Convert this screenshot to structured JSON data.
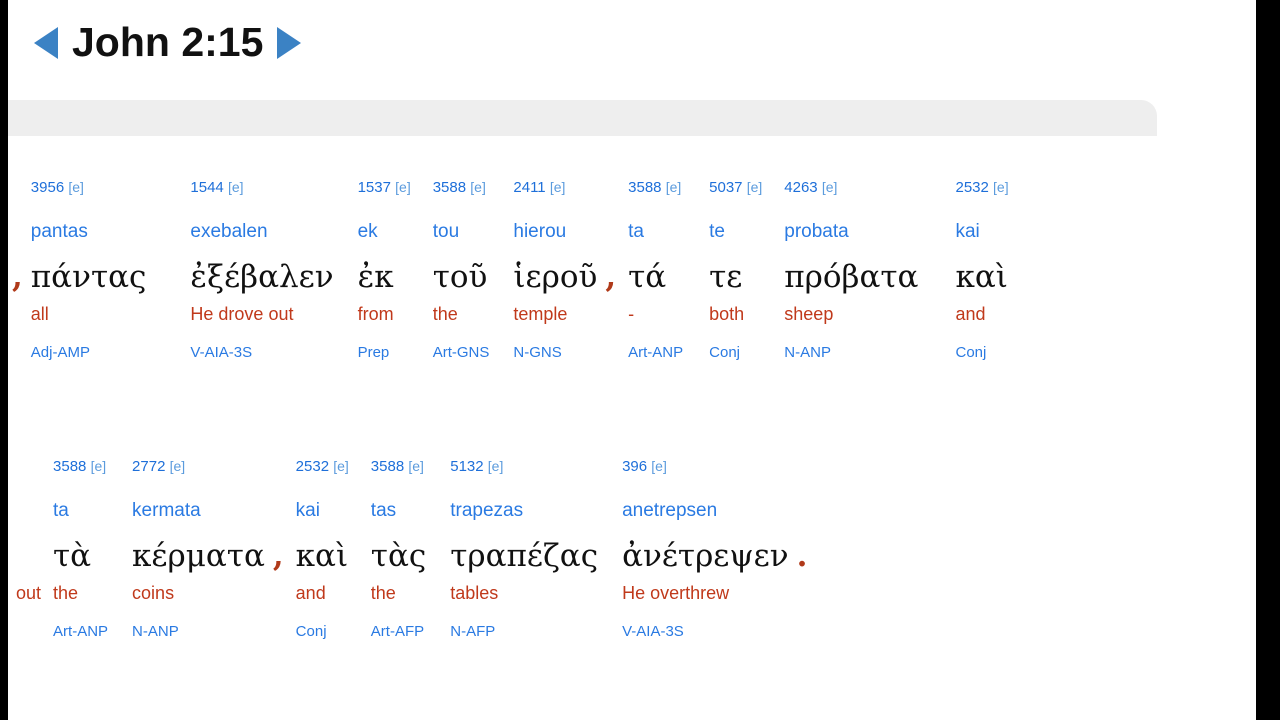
{
  "header": {
    "prev_icon": "triangle-left-icon",
    "next_icon": "triangle-right-icon",
    "title": "John 2:15",
    "accent_blue": "#3b82c4"
  },
  "colors": {
    "strong_number": "#1e6fd9",
    "transliteration": "#2a7ae2",
    "greek": "#111111",
    "gloss": "#c0391b",
    "parsing": "#2a7ae2",
    "punctuation": "#b03a1a",
    "toolbar_bar": "#eeeeee",
    "page_background": "#ffffff",
    "letterbox": "#000000"
  },
  "interlinear": {
    "rows": [
      {
        "lead_punctuation": ",",
        "lead_fragment": "",
        "words": [
          {
            "strong": "3956",
            "bracket": "[e]",
            "translit": "pantas",
            "greek": "πάντας",
            "gloss": "all",
            "parsing": "Adj-AMP",
            "gap_after": 44,
            "punct_after": ""
          },
          {
            "strong": "1544",
            "bracket": "[e]",
            "translit": "exebalen",
            "greek": "ἐξέβαλεν",
            "gloss": "He drove out",
            "parsing": "V-AIA-3S",
            "gap_after": 24,
            "punct_after": ""
          },
          {
            "strong": "1537",
            "bracket": "[e]",
            "translit": "ek",
            "greek": "ἐκ",
            "gloss": "from",
            "parsing": "Prep",
            "gap_after": 22,
            "punct_after": ""
          },
          {
            "strong": "3588",
            "bracket": "[e]",
            "translit": "tou",
            "greek": "τοῦ",
            "gloss": "the",
            "parsing": "Art-GNS",
            "gap_after": 24,
            "punct_after": ""
          },
          {
            "strong": "2411",
            "bracket": "[e]",
            "translit": "hierou",
            "greek": "ἱεροῦ",
            "gloss": "temple",
            "parsing": "N-GNS",
            "gap_after": 12,
            "punct_after": ","
          },
          {
            "strong": "3588",
            "bracket": "[e]",
            "translit": "ta",
            "greek": "τά",
            "gloss": "-",
            "parsing": "Art-ANP",
            "gap_after": 26,
            "punct_after": ""
          },
          {
            "strong": "5037",
            "bracket": "[e]",
            "translit": "te",
            "greek": "τε",
            "gloss": "both",
            "parsing": "Conj",
            "gap_after": 22,
            "punct_after": ""
          },
          {
            "strong": "4263",
            "bracket": "[e]",
            "translit": "probata",
            "greek": "πρόβατα",
            "gloss": "sheep",
            "parsing": "N-ANP",
            "gap_after": 37,
            "punct_after": ""
          },
          {
            "strong": "2532",
            "bracket": "[e]",
            "translit": "kai",
            "greek": "καὶ",
            "gloss": "and",
            "parsing": "Conj",
            "gap_after": 0,
            "punct_after": ""
          }
        ]
      },
      {
        "lead_punctuation": "",
        "lead_fragment": "out",
        "words": [
          {
            "strong": "3588",
            "bracket": "[e]",
            "translit": "ta",
            "greek": "τὰ",
            "gloss": "the",
            "parsing": "Art-ANP",
            "gap_after": 24,
            "punct_after": ""
          },
          {
            "strong": "2772",
            "bracket": "[e]",
            "translit": "kermata",
            "greek": "κέρματα",
            "gloss": "coins",
            "parsing": "N-ANP",
            "gap_after": 12,
            "punct_after": ","
          },
          {
            "strong": "2532",
            "bracket": "[e]",
            "translit": "kai",
            "greek": "καὶ",
            "gloss": "and",
            "parsing": "Conj",
            "gap_after": 22,
            "punct_after": ""
          },
          {
            "strong": "3588",
            "bracket": "[e]",
            "translit": "tas",
            "greek": "τὰς",
            "gloss": "the",
            "parsing": "Art-AFP",
            "gap_after": 24,
            "punct_after": ""
          },
          {
            "strong": "5132",
            "bracket": "[e]",
            "translit": "trapezas",
            "greek": "τραπέζας",
            "gloss": "tables",
            "parsing": "N-AFP",
            "gap_after": 24,
            "punct_after": ""
          },
          {
            "strong": "396",
            "bracket": "[e]",
            "translit": "anetrepsen",
            "greek": "ἀνέτρεψεν",
            "gloss": "He overthrew",
            "parsing": "V-AIA-3S",
            "gap_after": 12,
            "punct_after": "."
          }
        ]
      }
    ]
  }
}
